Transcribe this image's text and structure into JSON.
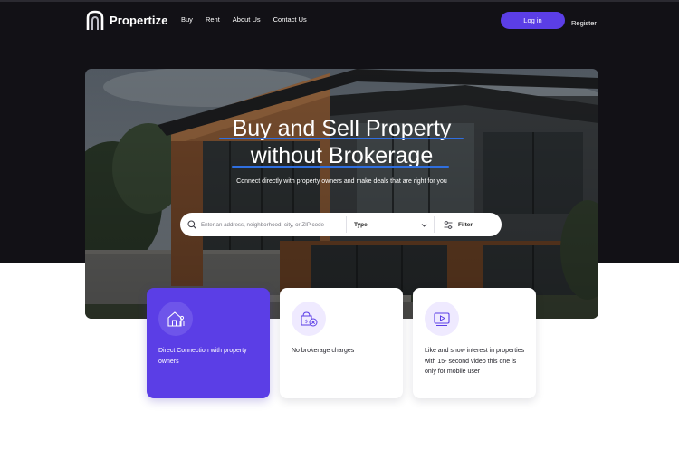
{
  "brand": {
    "name": "Propertize"
  },
  "nav": {
    "items": [
      "Buy",
      "Rent",
      "About Us",
      "Contact Us"
    ]
  },
  "auth": {
    "login_label": "Log in",
    "register_label": "Register"
  },
  "hero": {
    "headline_line1": "Buy and Sell Property",
    "headline_line2": "without Brokerage",
    "subtitle": "Connect directly with property owners and make deals that are right for you"
  },
  "search": {
    "placeholder": "Enter an address, neighborhood, city, or ZIP code",
    "type_label": "Type",
    "filter_label": "Filter"
  },
  "features": [
    {
      "icon": "home-person-icon",
      "text": "Direct Connection with property owners",
      "active": true
    },
    {
      "icon": "no-charge-icon",
      "text": "No brokerage charges",
      "active": false
    },
    {
      "icon": "video-icon",
      "text": "Like and show interest in properties with 15- second video this one is only for mobile user",
      "active": false
    }
  ],
  "colors": {
    "accent": "#5b3ee6",
    "dark_bg": "#121116",
    "underline": "#2f6fe0"
  }
}
